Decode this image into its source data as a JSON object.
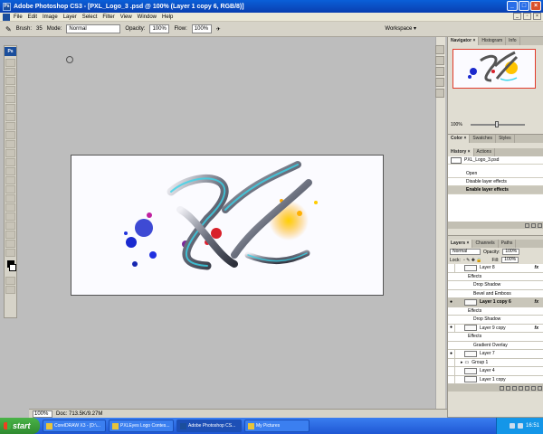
{
  "titlebar": {
    "title": "Adobe Photoshop CS3 - [PXL_Logo_3 .psd @ 100% (Layer 1 copy 6, RGB/8)]",
    "app_icon": "Ps"
  },
  "menu": [
    "File",
    "Edit",
    "Image",
    "Layer",
    "Select",
    "Filter",
    "View",
    "Window",
    "Help"
  ],
  "options": {
    "brush_label": "Brush:",
    "brush_size": "35",
    "mode_label": "Mode:",
    "mode_value": "Normal",
    "opacity_label": "Opacity:",
    "opacity_value": "100%",
    "flow_label": "Flow:",
    "flow_value": "100%",
    "workspace_label": "Workspace ▾"
  },
  "navigator": {
    "tabs": [
      "Navigator ×",
      "Histogram",
      "Info"
    ],
    "zoom": "100%"
  },
  "color": {
    "tabs": [
      "Color ×",
      "Swatches",
      "Styles"
    ]
  },
  "history": {
    "tabs": [
      "History ×",
      "Actions"
    ],
    "snapshot": "PXL_Logo_3.psd",
    "items": [
      "Open",
      "Disable layer effects",
      "Enable layer effects"
    ]
  },
  "layers": {
    "tabs": [
      "Layers ×",
      "Channels",
      "Paths"
    ],
    "blend_mode": "Normal",
    "opacity_label": "Opacity:",
    "opacity_value": "100%",
    "lock_label": "Lock:",
    "fill_label": "Fill:",
    "fill_value": "100%",
    "rows": [
      {
        "label": "Layer 8",
        "kind": "layer",
        "fx": "fx"
      },
      {
        "label": "Effects",
        "kind": "sub"
      },
      {
        "label": "Drop Shadow",
        "kind": "sub2"
      },
      {
        "label": "Bevel and Emboss",
        "kind": "sub2"
      },
      {
        "label": "Layer 1 copy 6",
        "kind": "layer",
        "fx": "fx",
        "selected": true
      },
      {
        "label": "Effects",
        "kind": "sub"
      },
      {
        "label": "Drop Shadow",
        "kind": "sub2"
      },
      {
        "label": "Layer 9 copy",
        "kind": "layer",
        "fx": "fx"
      },
      {
        "label": "Effects",
        "kind": "sub"
      },
      {
        "label": "Gradient Overlay",
        "kind": "sub2"
      },
      {
        "label": "Layer 7",
        "kind": "layer"
      },
      {
        "label": "Group 1",
        "kind": "group"
      },
      {
        "label": "Layer 4",
        "kind": "layer"
      },
      {
        "label": "Layer 1 copy",
        "kind": "layer"
      }
    ]
  },
  "status": {
    "zoom": "100%",
    "doc": "Doc: 713.5K/9.27M"
  },
  "taskbar": {
    "start": "start",
    "items": [
      {
        "label": "CorelDRAW X3 - [D:\\...",
        "active": false
      },
      {
        "label": "PXLEyes Logo Contes...",
        "active": false
      },
      {
        "label": "Adobe Photoshop CS...",
        "active": true
      },
      {
        "label": "My Pictures",
        "active": false
      }
    ],
    "clock": "16:51"
  }
}
